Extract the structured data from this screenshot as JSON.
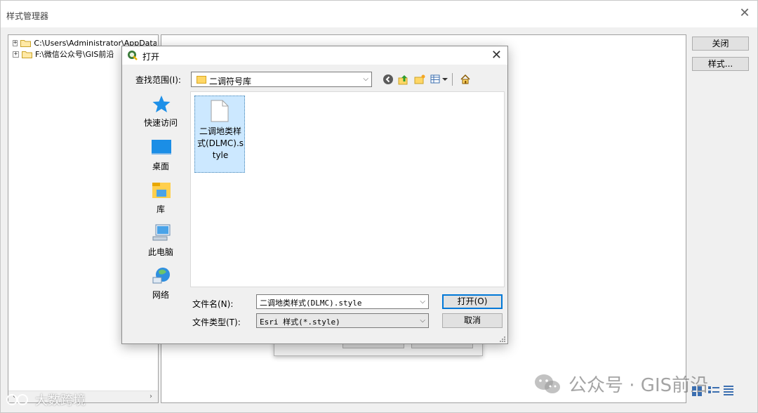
{
  "style_manager": {
    "title": "样式管理器",
    "close_glyph": "✕",
    "tree": [
      {
        "expander": "+",
        "label": "C:\\Users\\Administrator\\AppData\\Ro"
      },
      {
        "expander": "+",
        "label": "F:\\微信公众号\\GIS前沿"
      }
    ],
    "buttons": {
      "close": "关闭",
      "styles": "样式..."
    }
  },
  "open_dialog": {
    "title": "打开",
    "close_glyph": "✕",
    "look_in_label": "查找范围(I):",
    "look_in_value": "二调符号库",
    "places": [
      {
        "icon": "quick-access-star-icon",
        "label": "快速访问"
      },
      {
        "icon": "desktop-icon",
        "label": "桌面"
      },
      {
        "icon": "libraries-icon",
        "label": "库"
      },
      {
        "icon": "this-pc-icon",
        "label": "此电脑"
      },
      {
        "icon": "network-icon",
        "label": "网络"
      }
    ],
    "files": [
      {
        "name": "二调地类样式(DLMC).style"
      }
    ],
    "file_name_label": "文件名(N):",
    "file_name_value": "二调地类样式(DLMC).style",
    "file_type_label": "文件类型(T):",
    "file_type_value": "Esri 样式(*.style)",
    "open_button": "打开(O)",
    "cancel_button": "取消"
  },
  "watermarks": {
    "left": "大数跨境",
    "right": "公众号 · GIS前沿"
  },
  "colors": {
    "selection": "#cce8ff",
    "folder": "#ffd766",
    "accent": "#0078d7"
  }
}
